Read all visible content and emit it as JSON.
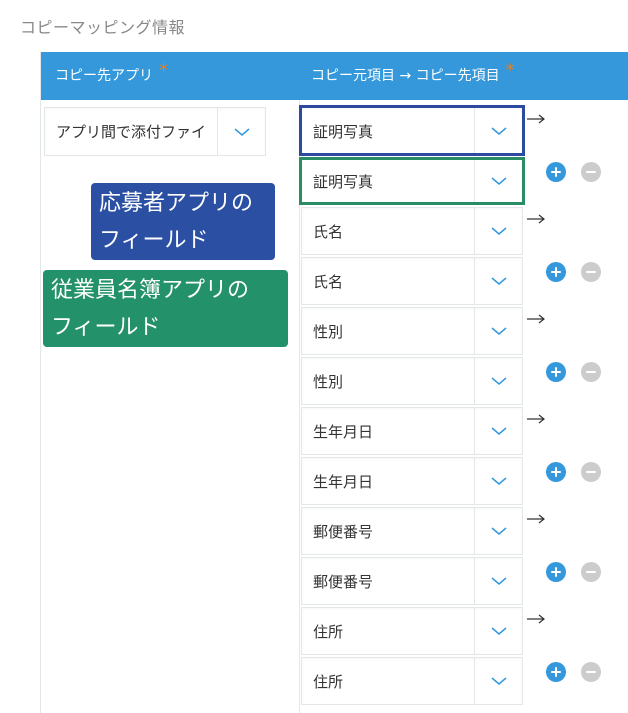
{
  "section_title": "コピーマッピング情報",
  "header": {
    "dest_app_label": "コピー先アプリ",
    "mapping_label": "コピー元項目 → コピー先項目",
    "required_mark": "*"
  },
  "dest_app": {
    "value": "アプリ間で添付ファイ"
  },
  "mappings": [
    {
      "source": "証明写真",
      "dest": "証明写真"
    },
    {
      "source": "氏名",
      "dest": "氏名"
    },
    {
      "source": "性別",
      "dest": "性別"
    },
    {
      "source": "生年月日",
      "dest": "生年月日"
    },
    {
      "source": "郵便番号",
      "dest": "郵便番号"
    },
    {
      "source": "住所",
      "dest": "住所"
    }
  ],
  "callouts": {
    "source_line1": "応募者アプリの",
    "source_line2": "フィールド",
    "dest_line1": "従業員名簿アプリの",
    "dest_line2": "フィールド"
  },
  "colors": {
    "header_bg": "#3498db",
    "required": "#e67e22",
    "add_button": "#3498db",
    "remove_button": "#cccccc",
    "highlight_blue": "#2b4aa0",
    "highlight_green": "#2a8c62"
  },
  "icons": {
    "chevron": "chevron-down-icon",
    "arrow": "arrow-right-icon",
    "add": "plus-icon",
    "remove": "minus-icon"
  }
}
